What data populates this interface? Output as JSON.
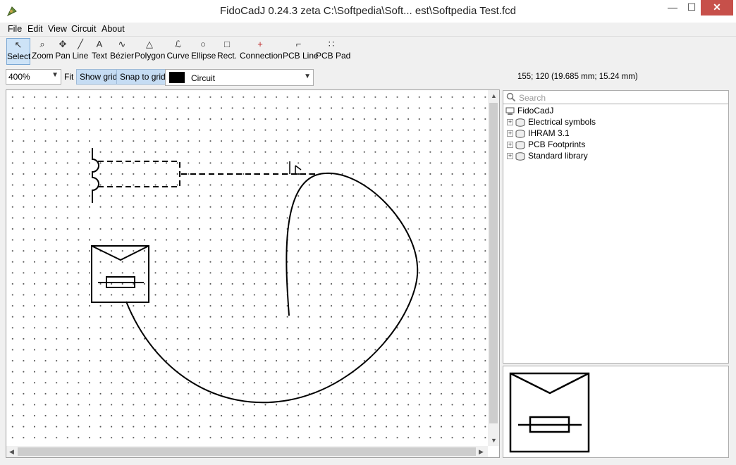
{
  "window": {
    "title": "FidoCadJ 0.24.3 zeta C:\\Softpedia\\Soft...  est\\Softpedia Test.fcd",
    "minimize": "—",
    "maximize": "☐",
    "close": "✕"
  },
  "menu": [
    "File",
    "Edit",
    "View",
    "Circuit",
    "About"
  ],
  "toolbar": {
    "tools": [
      {
        "label": "Select",
        "icon": "↖",
        "icon_name": "select-arrow-icon",
        "active": true
      },
      {
        "label": "Zoom",
        "icon": "⌕",
        "icon_name": "zoom-icon"
      },
      {
        "label": "Pan",
        "icon": "✥",
        "icon_name": "pan-icon"
      },
      {
        "label": "Line",
        "icon": "╱",
        "icon_name": "line-icon"
      },
      {
        "label": "Text",
        "icon": "A",
        "icon_name": "text-icon"
      },
      {
        "label": "Bézier",
        "icon": "∿",
        "icon_name": "bezier-icon"
      },
      {
        "label": "Polygon",
        "icon": "△",
        "icon_name": "polygon-icon"
      },
      {
        "label": "Curve",
        "icon": "ℒ",
        "icon_name": "curve-icon"
      },
      {
        "label": "Ellipse",
        "icon": "○",
        "icon_name": "ellipse-icon"
      },
      {
        "label": "Rect.",
        "icon": "□",
        "icon_name": "rectangle-icon"
      },
      {
        "label": "Connection",
        "icon": "+",
        "icon_name": "connection-icon"
      },
      {
        "label": "PCB Line",
        "icon": "⌐",
        "icon_name": "pcb-line-icon"
      },
      {
        "label": "PCB Pad",
        "icon": "∷",
        "icon_name": "pcb-pad-icon"
      }
    ]
  },
  "options": {
    "zoom": "400%",
    "fit": "Fit",
    "show_grid": "Show grid",
    "snap_to_grid": "Snap to grid",
    "layer": "Circuit",
    "layer_color": "#000000",
    "coords": "155; 120 (19.685 mm; 15.24 mm)"
  },
  "library": {
    "search_placeholder": "Search",
    "root": "FidoCadJ",
    "items": [
      "Electrical symbols",
      "IHRAM 3.1",
      "PCB Footprints",
      "Standard library"
    ]
  },
  "colors": {
    "accent": "#cde3f7",
    "close_button": "#c7504a"
  }
}
